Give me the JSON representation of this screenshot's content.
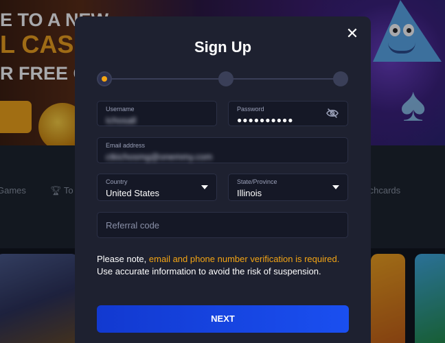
{
  "background": {
    "hero_line1": "E TO A NEW",
    "hero_line2": "L CAS",
    "hero_line3": "R FREE C",
    "nav_games": "Games",
    "nav_top": "To",
    "nav_scratchcards": "tchcards"
  },
  "modal": {
    "title": "Sign Up",
    "close_icon": "close-icon",
    "steps": [
      {
        "state": "active"
      },
      {
        "state": "inactive"
      },
      {
        "state": "inactive"
      }
    ],
    "username": {
      "label": "Username",
      "value": "Ichosall"
    },
    "password": {
      "label": "Password",
      "value": "●●●●●●●●●●",
      "toggle_icon": "eye-off-icon"
    },
    "email": {
      "label": "Email address",
      "value": "ctkichosmg@onemmy.com"
    },
    "country": {
      "label": "Country",
      "value": "United States"
    },
    "state": {
      "label": "State/Province",
      "value": "Illinois"
    },
    "referral": {
      "placeholder": "Referral code"
    },
    "notice": {
      "prefix": "Please note, ",
      "highlight": "email and phone number verification is required.",
      "suffix": " Use accurate information to avoid the risk of suspension."
    },
    "next_label": "NEXT"
  },
  "colors": {
    "accent": "#f4a514",
    "primary_button": "#1a4ff0",
    "modal_bg": "#1e2130"
  }
}
